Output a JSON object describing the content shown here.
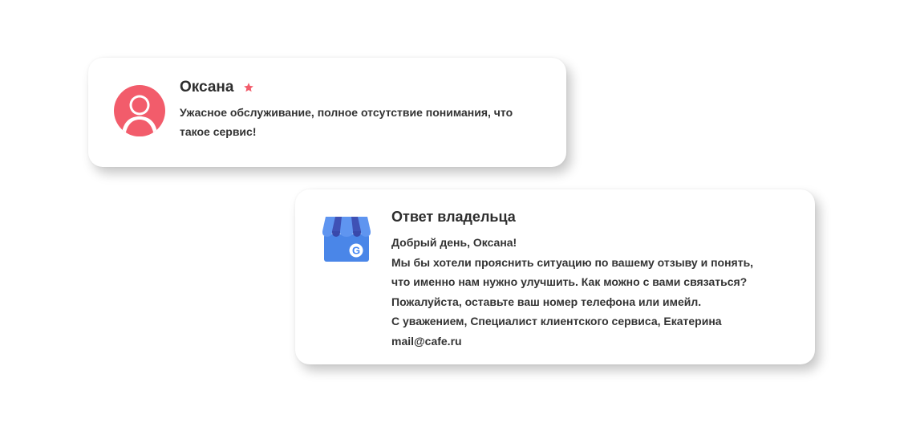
{
  "review": {
    "author": "Оксана",
    "avatar_icon": "user-avatar-icon",
    "rating_icon": "star-icon",
    "avatar_color": "#f25c6b",
    "text": "Ужасное обслуживание, полное отсутствие понимания, что такое сервис!"
  },
  "reply": {
    "title": "Ответ владельца",
    "icon": "google-my-business-icon",
    "lines": [
      "Добрый день, Оксана!",
      "Мы бы хотели прояснить ситуацию по вашему отзыву и понять,",
      "что именно нам нужно улучшить. Как можно с вами связаться?",
      "Пожалуйста, оставьте ваш номер телефона или имейл.",
      "С уважением, Специалист клиентского сервиса, Екатерина",
      "mail@cafe.ru"
    ]
  },
  "colors": {
    "accent_red": "#f25c6b",
    "google_blue": "#4285f4"
  }
}
